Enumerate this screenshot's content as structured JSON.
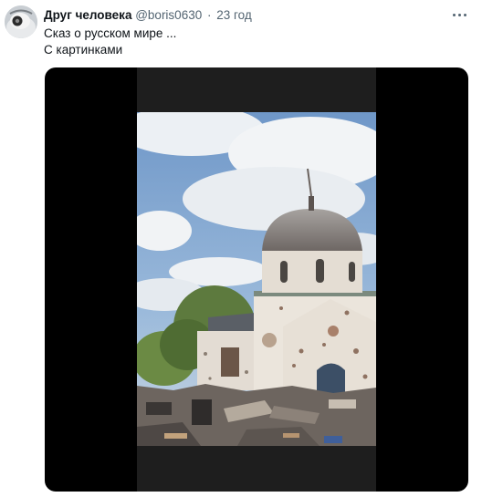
{
  "tweet": {
    "author": {
      "display_name": "Друг человека",
      "handle": "@boris0630",
      "separator": "·",
      "time": "23 год"
    },
    "text_lines": [
      "Сказ о русском мире ...",
      "С картинками"
    ],
    "media": {
      "type": "video",
      "subject": "damaged-church-photo"
    },
    "icons": {
      "more": "more-options-icon",
      "avatar": "avatar"
    }
  }
}
